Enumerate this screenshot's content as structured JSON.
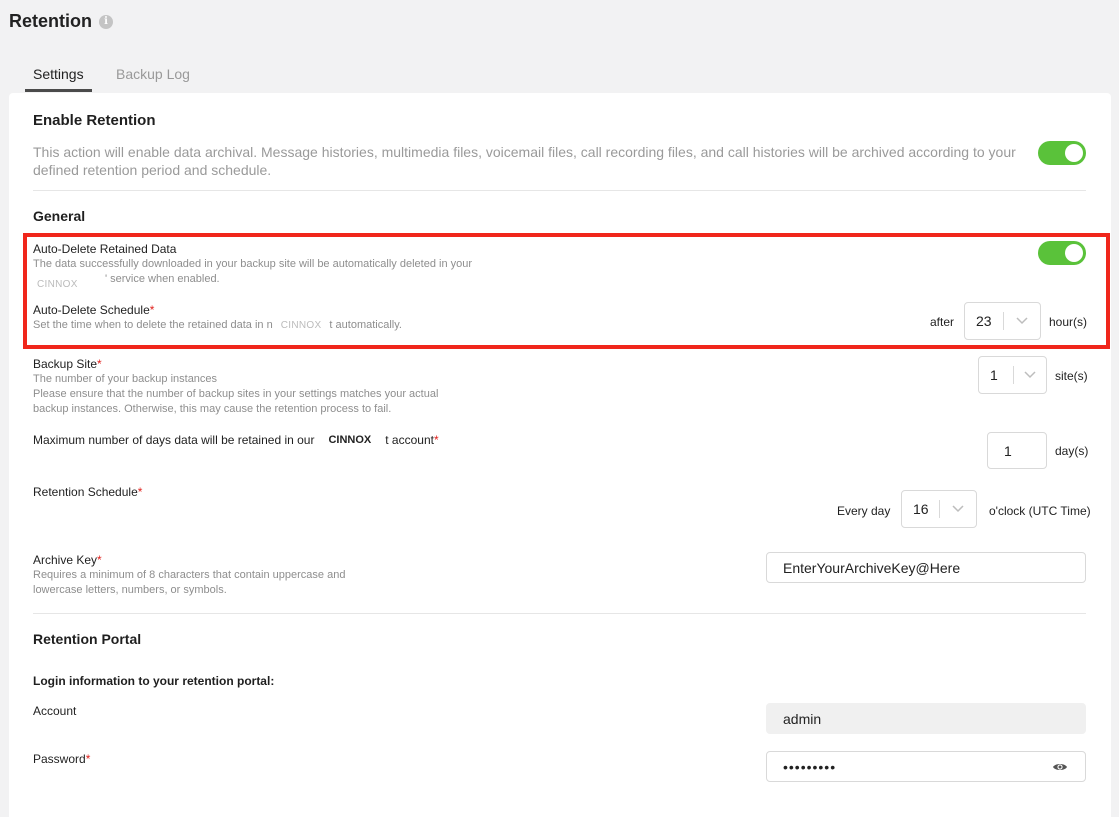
{
  "page": {
    "title": "Retention"
  },
  "tabs": [
    {
      "label": "Settings",
      "active": true
    },
    {
      "label": "Backup Log",
      "active": false
    }
  ],
  "enable_retention": {
    "title": "Enable Retention",
    "description_line1": "This action will enable data archival. Message histories, multimedia files, voicemail files, call recording files, and call histories will be archived according to your",
    "description_line2": "defined retention period and schedule.",
    "enabled": true
  },
  "general": {
    "title": "General",
    "auto_delete": {
      "label": "Auto-Delete Retained Data",
      "desc_line1": "The data successfully downloaded in your backup site will be automatically deleted in your",
      "brand": "CINNOX",
      "desc_line2_suffix": "' service when enabled.",
      "enabled": true
    },
    "auto_delete_schedule": {
      "label": "Auto-Delete Schedule",
      "required_mark": "*",
      "desc_prefix": "Set the time when to delete the retained data in n",
      "brand": "CINNOX",
      "desc_suffix": "t automatically.",
      "prefix": "after",
      "value": "23",
      "unit": "hour(s)"
    },
    "backup_site": {
      "label": "Backup Site",
      "required_mark": "*",
      "desc_line1": "The number of your backup instances",
      "desc_line2": "Please ensure that the number of backup sites in your settings matches your actual",
      "desc_line3": "backup instances. Otherwise, this may cause the retention process to fail.",
      "value": "1",
      "unit": "site(s)"
    },
    "max_days": {
      "label_prefix": "Maximum number of days data will be retained in our",
      "brand": "CINNOX",
      "label_suffix": "t account",
      "required_mark": "*",
      "value": "1",
      "unit": "day(s)"
    },
    "retention_schedule": {
      "label": "Retention Schedule",
      "required_mark": "*",
      "prefix": "Every day",
      "value": "16",
      "unit": "o'clock (UTC Time)"
    },
    "archive_key": {
      "label": "Archive Key",
      "required_mark": "*",
      "desc_line1": "Requires a minimum of 8 characters that contain uppercase and",
      "desc_line2": "lowercase letters, numbers, or symbols.",
      "value": "EnterYourArchiveKey@Here"
    }
  },
  "portal": {
    "title": "Retention Portal",
    "login_heading": "Login information to your retention portal:",
    "account": {
      "label": "Account",
      "value": "admin"
    },
    "password": {
      "label": "Password",
      "required_mark": "*",
      "value": "•••••••••"
    }
  },
  "colors": {
    "toggle_on": "#5ac23a",
    "highlight_border": "#f0261b",
    "required": "#e0201c"
  },
  "icons": {
    "info": "info-icon",
    "chevron": "chevron-down-icon",
    "eye": "eye-icon"
  }
}
